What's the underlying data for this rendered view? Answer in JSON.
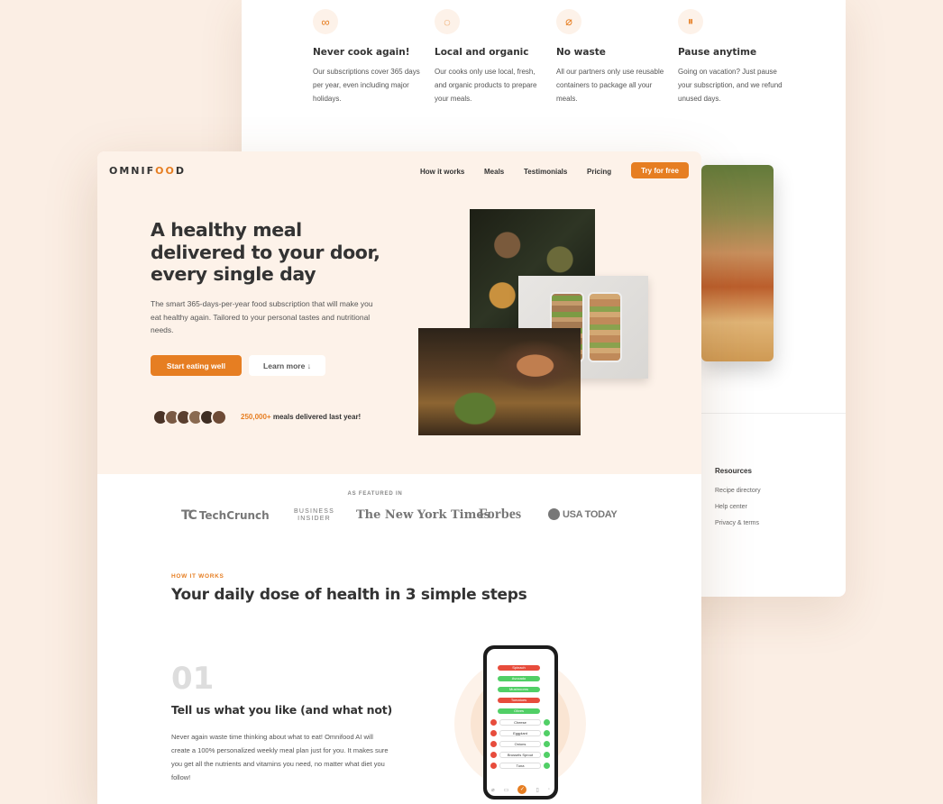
{
  "features": [
    {
      "icon": "infinity-icon",
      "glyph": "∞",
      "title": "Never cook again!",
      "description": "Our subscriptions cover 365 days per year, even including major holidays."
    },
    {
      "icon": "apple-icon",
      "glyph": "◌",
      "title": "Local and organic",
      "description": "Our cooks only use local, fresh, and organic products to prepare your meals."
    },
    {
      "icon": "leaf-icon",
      "glyph": "⌀",
      "title": "No waste",
      "description": "All our partners only use reusable containers to package all your meals."
    },
    {
      "icon": "pause-icon",
      "glyph": "⏸",
      "title": "Pause anytime",
      "description": "Going on vacation? Just pause your subscription, and we refund unused days."
    }
  ],
  "footer": {
    "heading": "Resources",
    "links": [
      "Recipe directory",
      "Help center",
      "Privacy & terms"
    ]
  },
  "header": {
    "logo_prefix": "OMNIF",
    "logo_mark": "OO",
    "logo_suffix": "D",
    "nav": [
      "How it works",
      "Meals",
      "Testimonials",
      "Pricing"
    ],
    "cta": "Try for free"
  },
  "hero": {
    "title": "A healthy meal delivered to your door, every single day",
    "description": "The smart 365-days-per-year food subscription that will make you eat healthy again. Tailored to your personal tastes and nutritional needs.",
    "primary_button": "Start eating well",
    "secondary_button": "Learn more ↓",
    "customers_count": "250,000+",
    "customers_text": "meals delivered last year!"
  },
  "featured": {
    "label": "AS FEATURED IN",
    "brands": {
      "techcrunch_mark": "TC",
      "techcrunch": "TechCrunch",
      "business_insider_1": "BUSINESS",
      "business_insider_2": "INSIDER",
      "nyt": "The New York Times",
      "forbes": "Forbes",
      "usatoday": "USA TODAY"
    }
  },
  "how": {
    "subheading": "HOW IT WORKS",
    "heading": "Your daily dose of health in 3 simple steps",
    "step_number": "01",
    "step_title": "Tell us what you like (and what not)",
    "step_description": "Never again waste time thinking about what to eat! Omnifood AI will create a 100% personalized weekly meal plan just for you. It makes sure you get all the nutrients and vitamins you need, no matter what diet you follow!"
  },
  "phone": {
    "pills": [
      {
        "label": "Spinach",
        "color": "#e74c3c"
      },
      {
        "label": "Avocado",
        "color": "#51cf66"
      },
      {
        "label": "Mushrooms",
        "color": "#51cf66"
      },
      {
        "label": "Tomatoes",
        "color": "#e74c3c"
      },
      {
        "label": "Olives",
        "color": "#51cf66"
      }
    ],
    "rows": [
      "Cheese",
      "Eggplant",
      "Onions",
      "Brussels Sprout",
      "Tuna"
    ]
  },
  "colors": {
    "accent": "#e67e22",
    "tint": "#fdf2e9"
  }
}
